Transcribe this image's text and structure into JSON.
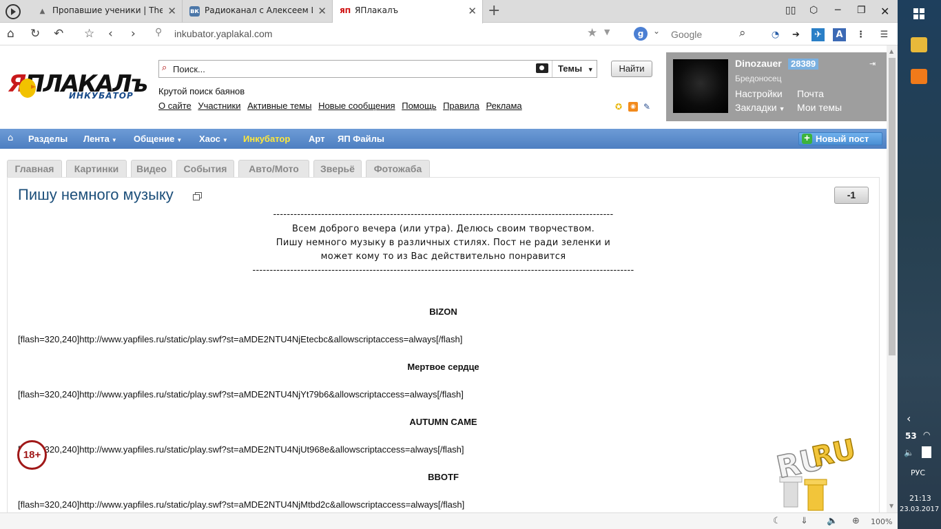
{
  "browser": {
    "tabs": [
      {
        "title": "Пропавшие ученики | The Eld",
        "favicon": "tes-icon"
      },
      {
        "title": "Радиоканал с Алексеем Игон",
        "favicon": "vk-icon"
      },
      {
        "title": "ЯПлакалъ",
        "favicon": "yap-icon"
      }
    ],
    "url": "inkubator.yaplakal.com",
    "search_engine_label": "Google",
    "zoom": "100%"
  },
  "site": {
    "logo_text": "ЯПЛАКАЛъ",
    "logo_sub": "ИНКУБАТОР",
    "search_placeholder": "Поиск...",
    "search_scope": "Темы",
    "search_button": "Найти",
    "tagline": "Крутой поиск баянов",
    "links": [
      "О сайте",
      "Участники",
      "Активные темы",
      "Новые сообщения",
      "Помощь",
      "Правила",
      "Реклама"
    ]
  },
  "user": {
    "name": "Dinozauer",
    "rep": "28389",
    "rank": "Бредоносец",
    "links": [
      "Настройки",
      "Почта",
      "Закладки",
      "Мои темы"
    ]
  },
  "nav": {
    "items": [
      "Разделы",
      "Лента",
      "Общение",
      "Хаос",
      "Инкубатор",
      "Арт",
      "ЯП Файлы"
    ],
    "new_post": "Новый пост"
  },
  "subtabs": [
    "Главная",
    "Картинки",
    "Видео",
    "События",
    "Авто/Мото",
    "Зверьё",
    "Фотожаба"
  ],
  "post": {
    "title": "Пишу немного музыку",
    "vote": "-1",
    "divider_top": "---------------------------------------------------------------------------------------------------",
    "intro": [
      "Всем доброго вечера (или утра). Делюсь своим творчеством.",
      "Пишу немного музыку в различных стилях. Пост не ради зеленки и",
      "может кому то из Вас действительно понравится"
    ],
    "divider_bottom": "---------------------------------------------------------------------------------------------------------------",
    "tracks": [
      {
        "name": "BIZON",
        "embed": "[flash=320,240]http://www.yapfiles.ru/static/play.swf?st=aMDE2NTU4NjEtecbc&allowscriptaccess=always[/flash]"
      },
      {
        "name": "Мертвое сердце",
        "embed": "[flash=320,240]http://www.yapfiles.ru/static/play.swf?st=aMDE2NTU4NjYt79b6&allowscriptaccess=always[/flash]"
      },
      {
        "name": "AUTUMN CAME",
        "embed": "[flash=320,240]http://www.yapfiles.ru/static/play.swf?st=aMDE2NTU4NjUt968e&allowscriptaccess=always[/flash]"
      },
      {
        "name": "BBOTF",
        "embed": "[flash=320,240]http://www.yapfiles.ru/static/play.swf?st=aMDE2NTU4NjMtbd2c&allowscriptaccess=always[/flash]"
      }
    ],
    "age_badge": "18+",
    "ru_badge": "RU"
  },
  "system": {
    "lang": "РУС",
    "time": "21:13",
    "date": "23.03.2017",
    "battery": "53"
  },
  "colors": {
    "nav_bg": "#5a8ccc",
    "nav_highlight": "#ffe83a",
    "title": "#1c4f7a",
    "userbox": "#9e9e9e"
  }
}
